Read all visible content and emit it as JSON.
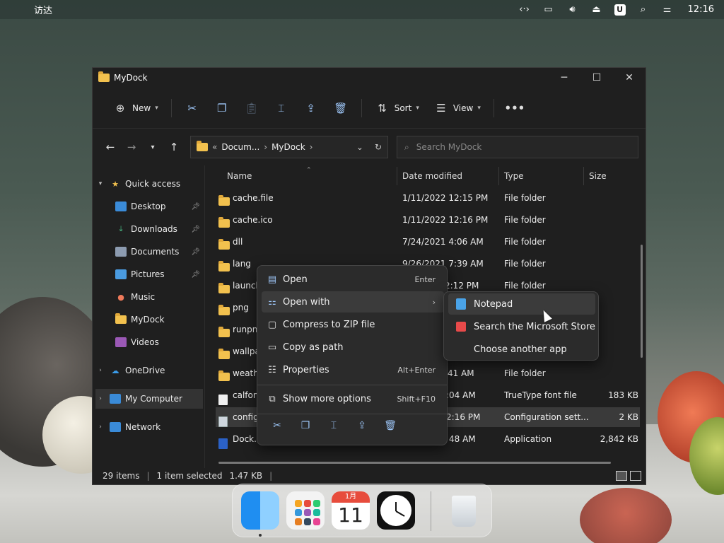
{
  "menubar": {
    "app_name": "访达",
    "clock": "12:16",
    "icons": [
      "apple-icon",
      "code-icon",
      "display-icon",
      "volume-icon",
      "eject-icon",
      "u-icon",
      "search-icon",
      "control-center-icon"
    ]
  },
  "window": {
    "title": "MyDock",
    "toolbar": {
      "new_label": "New",
      "sort_label": "Sort",
      "view_label": "View"
    },
    "address": {
      "prefix": "«",
      "crumbs": [
        "Docum...",
        "MyDock"
      ]
    },
    "search_placeholder": "Search MyDock",
    "sidebar": {
      "quick_access": "Quick access",
      "items": [
        {
          "label": "Desktop",
          "pinned": true
        },
        {
          "label": "Downloads",
          "pinned": true
        },
        {
          "label": "Documents",
          "pinned": true
        },
        {
          "label": "Pictures",
          "pinned": true
        },
        {
          "label": "Music",
          "pinned": false
        },
        {
          "label": "MyDock",
          "pinned": false
        },
        {
          "label": "Videos",
          "pinned": false
        }
      ],
      "onedrive": "OneDrive",
      "my_computer": "My Computer",
      "network": "Network"
    },
    "columns": {
      "name": "Name",
      "date": "Date modified",
      "type": "Type",
      "size": "Size"
    },
    "files": [
      {
        "name": "cache.file",
        "date": "1/11/2022 12:15 PM",
        "type": "File folder",
        "size": ""
      },
      {
        "name": "cache.ico",
        "date": "1/11/2022 12:16 PM",
        "type": "File folder",
        "size": ""
      },
      {
        "name": "dll",
        "date": "7/24/2021 4:06 AM",
        "type": "File folder",
        "size": ""
      },
      {
        "name": "lang",
        "date": "9/26/2021 7:39 AM",
        "type": "File folder",
        "size": ""
      },
      {
        "name": "launch",
        "date": "2:12 PM",
        "type": "File folder",
        "size": ""
      },
      {
        "name": "png",
        "date": "",
        "type": "",
        "size": ""
      },
      {
        "name": "runpng",
        "date": "",
        "type": "",
        "size": ""
      },
      {
        "name": "wallpa",
        "date": "",
        "type": "",
        "size": ""
      },
      {
        "name": "weath",
        "date": "41 AM",
        "type": "File folder",
        "size": ""
      },
      {
        "name": "calfon",
        "date": ":04 AM",
        "type": "TrueType font file",
        "size": "183 KB"
      },
      {
        "name": "config",
        "date": "2:16 PM",
        "type": "Configuration sett...",
        "size": "2 KB"
      },
      {
        "name": "Dock.e",
        "date": "48 AM",
        "type": "Application",
        "size": "2,842 KB"
      }
    ],
    "status": {
      "items": "29 items",
      "selected": "1 item selected",
      "size": "1.47 KB"
    }
  },
  "context_menu": {
    "items": [
      {
        "label": "Open",
        "shortcut": "Enter"
      },
      {
        "label": "Open with",
        "shortcut": ""
      },
      {
        "label": "Compress to ZIP file",
        "shortcut": ""
      },
      {
        "label": "Copy as path",
        "shortcut": ""
      },
      {
        "label": "Properties",
        "shortcut": "Alt+Enter"
      },
      {
        "label": "Show more options",
        "shortcut": "Shift+F10"
      }
    ]
  },
  "submenu": {
    "items": [
      "Notepad",
      "Search the Microsoft Store",
      "Choose another app"
    ]
  },
  "dock": {
    "calendar_month": "1月",
    "calendar_day": "11"
  }
}
